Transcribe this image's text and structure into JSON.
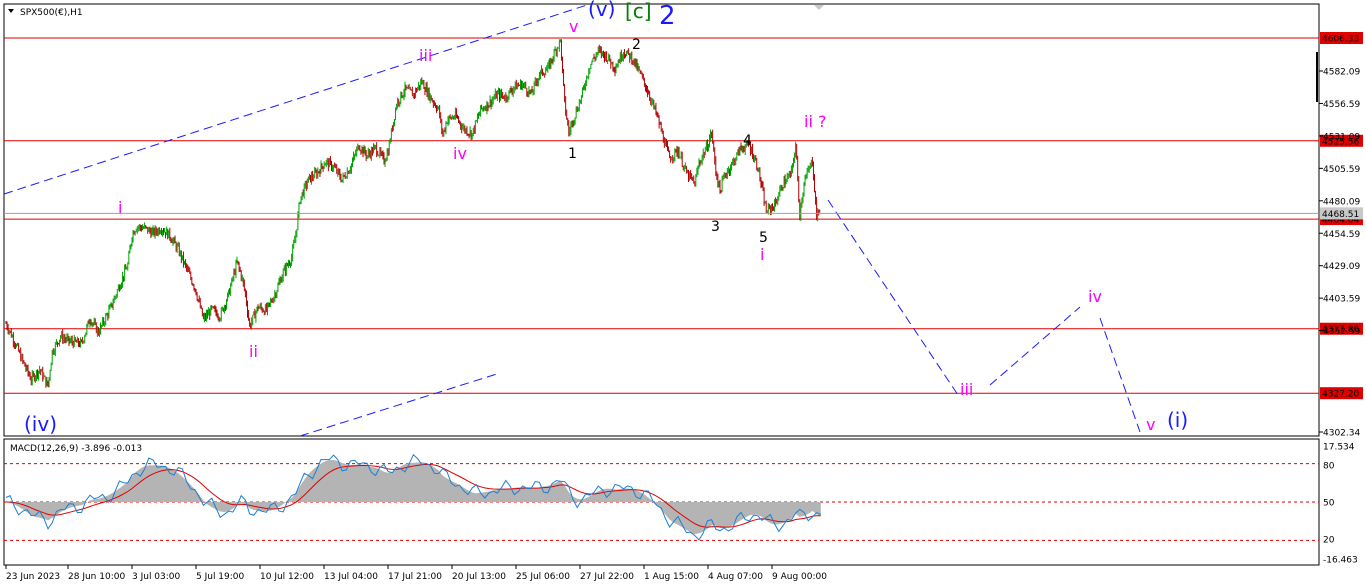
{
  "chart_data": [
    {
      "type": "line",
      "title": "SPX500(€),H1",
      "xlabel": "",
      "ylabel": "",
      "ylim": [
        4296,
        4640
      ],
      "grid": false,
      "x_ticks": [
        "23 Jun 2023",
        "28 Jun 10:00",
        "3 Jul 03:00",
        "5 Jul 19:00",
        "10 Jul 12:00",
        "13 Jul 04:00",
        "17 Jul 21:00",
        "20 Jul 13:00",
        "25 Jul 06:00",
        "27 Jul 22:00",
        "1 Aug 15:00",
        "4 Aug 07:00",
        "9 Aug 00:00"
      ],
      "y_ticks": [
        "4582.09",
        "4556.59",
        "4531.09",
        "4505.59",
        "4480.09",
        "4454.59",
        "4429.09",
        "4403.59",
        "4352.59",
        "4302.34"
      ],
      "levels": [
        {
          "label": "4606.33",
          "value": 4606.33
        },
        {
          "label": "4525.56",
          "value": 4525.56
        },
        {
          "label": "4464.04",
          "value": 4464.04
        },
        {
          "label": "4377.86",
          "value": 4377.86
        },
        {
          "label": "4327.20",
          "value": 4327.2
        }
      ],
      "current_price": {
        "label": "4468.51",
        "value": 4468.51
      },
      "price_anchors": [
        [
          0,
          4382
        ],
        [
          2,
          4368
        ],
        [
          4,
          4352
        ],
        [
          6,
          4338
        ],
        [
          8,
          4346
        ],
        [
          10,
          4333
        ],
        [
          11,
          4360
        ],
        [
          13,
          4372
        ],
        [
          15,
          4368
        ],
        [
          18,
          4366
        ],
        [
          20,
          4386
        ],
        [
          22,
          4375
        ],
        [
          25,
          4395
        ],
        [
          27,
          4412
        ],
        [
          29,
          4428
        ],
        [
          30,
          4452
        ],
        [
          31,
          4458
        ],
        [
          33,
          4457
        ],
        [
          35,
          4453
        ],
        [
          37,
          4457
        ],
        [
          39,
          4451
        ],
        [
          41,
          4440
        ],
        [
          43,
          4425
        ],
        [
          45,
          4410
        ],
        [
          47,
          4385
        ],
        [
          49,
          4393
        ],
        [
          51,
          4388
        ],
        [
          53,
          4405
        ],
        [
          55,
          4430
        ],
        [
          56,
          4420
        ],
        [
          57,
          4405
        ],
        [
          58,
          4380
        ],
        [
          60,
          4395
        ],
        [
          62,
          4392
        ],
        [
          64,
          4405
        ],
        [
          66,
          4422
        ],
        [
          68,
          4434
        ],
        [
          69,
          4452
        ],
        [
          70,
          4480
        ],
        [
          72,
          4495
        ],
        [
          74,
          4500
        ],
        [
          76,
          4509
        ],
        [
          78,
          4505
        ],
        [
          80,
          4495
        ],
        [
          82,
          4505
        ],
        [
          84,
          4522
        ],
        [
          86,
          4514
        ],
        [
          88,
          4520
        ],
        [
          90,
          4510
        ],
        [
          91,
          4518
        ],
        [
          93,
          4555
        ],
        [
          95,
          4566
        ],
        [
          97,
          4562
        ],
        [
          99,
          4572
        ],
        [
          101,
          4560
        ],
        [
          103,
          4550
        ],
        [
          104,
          4530
        ],
        [
          105,
          4542
        ],
        [
          107,
          4545
        ],
        [
          109,
          4535
        ],
        [
          111,
          4531
        ],
        [
          113,
          4550
        ],
        [
          115,
          4555
        ],
        [
          117,
          4562
        ],
        [
          119,
          4560
        ],
        [
          121,
          4568
        ],
        [
          123,
          4570
        ],
        [
          125,
          4562
        ],
        [
          127,
          4578
        ],
        [
          129,
          4582
        ],
        [
          131,
          4598
        ],
        [
          132,
          4604
        ],
        [
          133,
          4555
        ],
        [
          134,
          4532
        ],
        [
          135,
          4542
        ],
        [
          137,
          4560
        ],
        [
          139,
          4585
        ],
        [
          141,
          4596
        ],
        [
          143,
          4592
        ],
        [
          145,
          4583
        ],
        [
          147,
          4596
        ],
        [
          149,
          4591
        ],
        [
          151,
          4578
        ],
        [
          153,
          4563
        ],
        [
          155,
          4545
        ],
        [
          157,
          4522
        ],
        [
          158,
          4512
        ],
        [
          160,
          4518
        ],
        [
          162,
          4500
        ],
        [
          164,
          4492
        ],
        [
          165,
          4508
        ],
        [
          167,
          4522
        ],
        [
          168,
          4532
        ],
        [
          169,
          4502
        ],
        [
          170,
          4486
        ],
        [
          171,
          4498
        ],
        [
          173,
          4508
        ],
        [
          175,
          4520
        ],
        [
          177,
          4522
        ],
        [
          179,
          4505
        ],
        [
          181,
          4470
        ],
        [
          183,
          4475
        ],
        [
          185,
          4492
        ],
        [
          187,
          4500
        ],
        [
          188,
          4522
        ],
        [
          189,
          4468
        ],
        [
          190,
          4493
        ],
        [
          192,
          4510
        ],
        [
          193,
          4466
        ],
        [
          194,
          4474
        ]
      ]
    },
    {
      "type": "line",
      "title": "MACD(12,26,9) -3.896 -0.013",
      "xlabel": "",
      "ylabel": "",
      "ylim": [
        -20,
        20
      ],
      "grid": false,
      "y_ticks": [
        "17.534",
        "80",
        "50",
        "20",
        "-16.463"
      ],
      "levels": [
        {
          "label": "80",
          "value": 12.8
        },
        {
          "label": "50",
          "value": 0
        },
        {
          "label": "20",
          "value": -12.8
        }
      ]
    }
  ],
  "annotations": [
    {
      "text": "(iv)",
      "color": "#1a1aff",
      "size": 20
    },
    {
      "text": "i",
      "color": "#ff00ff",
      "size": 16
    },
    {
      "text": "ii",
      "color": "#ff00ff",
      "size": 16
    },
    {
      "text": "iii",
      "color": "#ff00ff",
      "size": 16
    },
    {
      "text": "iv",
      "color": "#ff00ff",
      "size": 16
    },
    {
      "text": "v",
      "color": "#ff00ff",
      "size": 16
    },
    {
      "text": "(v)",
      "color": "#1a1aff",
      "size": 20
    },
    {
      "text": "[c]",
      "color": "#008000",
      "size": 20
    },
    {
      "text": "2",
      "color": "#1a1aff",
      "size": 26
    },
    {
      "text": "1",
      "color": "#000000",
      "size": 14
    },
    {
      "text": "2",
      "color": "#000000",
      "size": 14
    },
    {
      "text": "3",
      "color": "#000000",
      "size": 14
    },
    {
      "text": "4",
      "color": "#000000",
      "size": 14
    },
    {
      "text": "5",
      "color": "#000000",
      "size": 14
    },
    {
      "text": "i",
      "color": "#ff00ff",
      "size": 16
    },
    {
      "text": "ii ?",
      "color": "#ff00ff",
      "size": 16
    },
    {
      "text": "iii",
      "color": "#ff00ff",
      "size": 16
    },
    {
      "text": "iv",
      "color": "#ff00ff",
      "size": 16
    },
    {
      "text": "v",
      "color": "#ff00ff",
      "size": 16
    },
    {
      "text": "(i)",
      "color": "#1a1aff",
      "size": 20
    }
  ],
  "colors": {
    "bull": "#00a000",
    "bear": "#b00000",
    "level": "#e00000",
    "macd_line": "#1a7fd6",
    "signal": "#e00000",
    "hist": "#b4b4b4",
    "trend": "#1a1aff",
    "axis": "#000000",
    "price_box": "#e00000"
  }
}
